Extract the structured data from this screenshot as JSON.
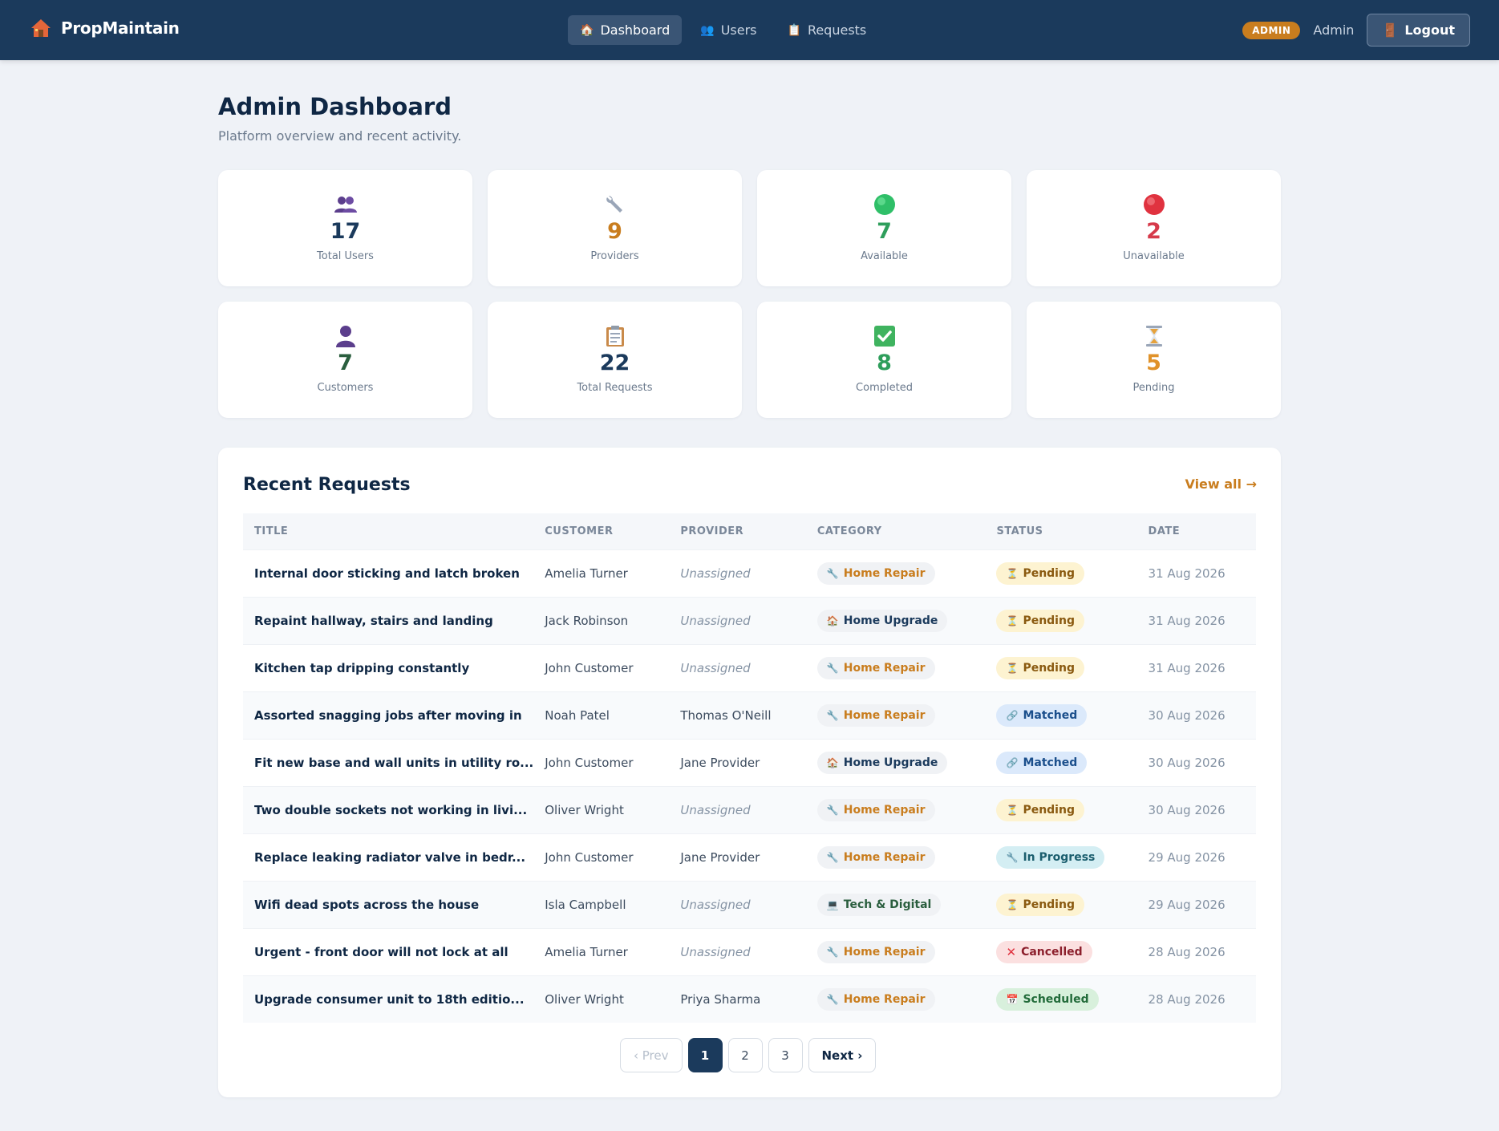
{
  "brand": {
    "name": "PropMaintain",
    "icon": "house-icon"
  },
  "nav": {
    "items": [
      {
        "label": "Dashboard",
        "icon": "house-icon",
        "active": true
      },
      {
        "label": "Users",
        "icon": "users-icon",
        "active": false
      },
      {
        "label": "Requests",
        "icon": "clipboard-icon",
        "active": false
      }
    ],
    "role_badge": "ADMIN",
    "user_name": "Admin",
    "logout_label": "Logout"
  },
  "header": {
    "title": "Admin Dashboard",
    "subtitle": "Platform overview and recent activity."
  },
  "stats": [
    {
      "value": "17",
      "label": "Total Users",
      "icon": "users-icon",
      "color": "#1b3a5c"
    },
    {
      "value": "9",
      "label": "Providers",
      "icon": "wrench-icon",
      "color": "#c97d1e"
    },
    {
      "value": "7",
      "label": "Available",
      "icon": "green-circle-icon",
      "color": "#2e9e5b"
    },
    {
      "value": "2",
      "label": "Unavailable",
      "icon": "red-circle-icon",
      "color": "#d63a4a"
    },
    {
      "value": "7",
      "label": "Customers",
      "icon": "user-icon",
      "color": "#2a5e3e"
    },
    {
      "value": "22",
      "label": "Total Requests",
      "icon": "clipboard-icon",
      "color": "#1b3a5c"
    },
    {
      "value": "8",
      "label": "Completed",
      "icon": "check-icon",
      "color": "#2e9e5b"
    },
    {
      "value": "5",
      "label": "Pending",
      "icon": "hourglass-icon",
      "color": "#e0922a"
    }
  ],
  "recent": {
    "title": "Recent Requests",
    "view_all": "View all →",
    "columns": [
      "TITLE",
      "CUSTOMER",
      "PROVIDER",
      "CATEGORY",
      "STATUS",
      "DATE"
    ],
    "rows": [
      {
        "title": "Internal door sticking and latch broken",
        "customer": "Amelia Turner",
        "provider": "Unassigned",
        "category": "Home Repair",
        "status": "Pending",
        "date": "31 Aug 2026"
      },
      {
        "title": "Repaint hallway, stairs and landing",
        "customer": "Jack Robinson",
        "provider": "Unassigned",
        "category": "Home Upgrade",
        "status": "Pending",
        "date": "31 Aug 2026"
      },
      {
        "title": "Kitchen tap dripping constantly",
        "customer": "John Customer",
        "provider": "Unassigned",
        "category": "Home Repair",
        "status": "Pending",
        "date": "31 Aug 2026"
      },
      {
        "title": "Assorted snagging jobs after moving in",
        "customer": "Noah Patel",
        "provider": "Thomas O'Neill",
        "category": "Home Repair",
        "status": "Matched",
        "date": "30 Aug 2026"
      },
      {
        "title": "Fit new base and wall units in utility ro...",
        "customer": "John Customer",
        "provider": "Jane Provider",
        "category": "Home Upgrade",
        "status": "Matched",
        "date": "30 Aug 2026"
      },
      {
        "title": "Two double sockets not working in livi...",
        "customer": "Oliver Wright",
        "provider": "Unassigned",
        "category": "Home Repair",
        "status": "Pending",
        "date": "30 Aug 2026"
      },
      {
        "title": "Replace leaking radiator valve in bedr...",
        "customer": "John Customer",
        "provider": "Jane Provider",
        "category": "Home Repair",
        "status": "In Progress",
        "date": "29 Aug 2026"
      },
      {
        "title": "Wifi dead spots across the house",
        "customer": "Isla Campbell",
        "provider": "Unassigned",
        "category": "Tech & Digital",
        "status": "Pending",
        "date": "29 Aug 2026"
      },
      {
        "title": "Urgent - front door will not lock at all",
        "customer": "Amelia Turner",
        "provider": "Unassigned",
        "category": "Home Repair",
        "status": "Cancelled",
        "date": "28 Aug 2026"
      },
      {
        "title": "Upgrade consumer unit to 18th editio...",
        "customer": "Oliver Wright",
        "provider": "Priya Sharma",
        "category": "Home Repair",
        "status": "Scheduled",
        "date": "28 Aug 2026"
      }
    ]
  },
  "pagination": {
    "prev": "‹ Prev",
    "pages": [
      "1",
      "2",
      "3"
    ],
    "current": "1",
    "next": "Next ›"
  }
}
